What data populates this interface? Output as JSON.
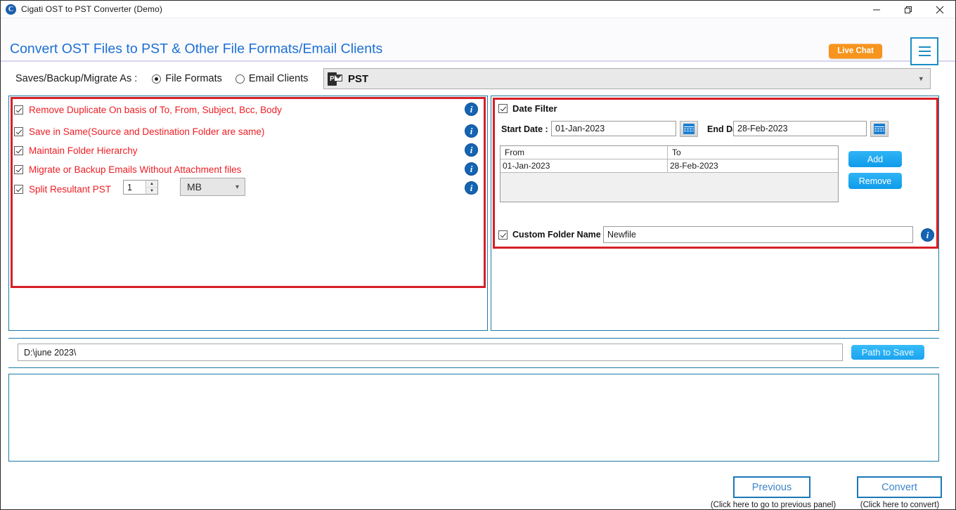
{
  "window": {
    "title": "Cigati OST to PST Converter (Demo)",
    "logo_letter": "C",
    "minimize_icon": "minimize-icon",
    "maximize_icon": "maximize-icon",
    "close_icon": "close-icon"
  },
  "header": {
    "title": "Convert OST Files to PST & Other File Formats/Email Clients",
    "live_chat_label": "Live Chat",
    "menu_icon": "hamburger-menu-icon"
  },
  "save_row": {
    "label": "Saves/Backup/Migrate As :",
    "options": [
      {
        "label": "File Formats",
        "selected": true
      },
      {
        "label": "Email Clients",
        "selected": false
      }
    ],
    "format_select": {
      "value": "PST",
      "icon": "outlook-pst-file-icon",
      "arrow": "chevron-down-icon"
    }
  },
  "left_panel": {
    "options": [
      {
        "label": "Remove Duplicate On basis of To, From, Subject, Bcc, Body",
        "checked": true,
        "info": "i"
      },
      {
        "label": "Save in Same(Source and Destination Folder are same)",
        "checked": true,
        "info": "i"
      },
      {
        "label": "Maintain Folder Hierarchy",
        "checked": true,
        "info": "i"
      },
      {
        "label": "Migrate or Backup Emails Without Attachment files",
        "checked": true,
        "info": "i"
      },
      {
        "label": "Split Resultant PST",
        "checked": true,
        "info": "i"
      }
    ],
    "split_size": "1",
    "split_unit": "MB",
    "split_unit_arrow": "chevron-down-icon",
    "spinner_up": "▲",
    "spinner_down": "▼"
  },
  "right_panel": {
    "date_filter": {
      "label": "Date Filter",
      "checked": true,
      "start_label": "Start Date :",
      "start_value": "01-Jan-2023",
      "end_label": "End Date :",
      "end_value": "28-Feb-2023",
      "calendar_icon": "calendar-icon"
    },
    "grid": {
      "columns": [
        "From",
        "To"
      ],
      "rows": [
        {
          "from": "01-Jan-2023",
          "to": "28-Feb-2023"
        }
      ]
    },
    "add_label": "Add",
    "remove_label": "Remove",
    "custom_folder": {
      "label": "Custom Folder Name",
      "checked": true,
      "value": "Newfile",
      "info": "i"
    }
  },
  "path_row": {
    "value": "D:\\june 2023\\",
    "placeholder": "",
    "button_label": "Path to Save"
  },
  "footer": {
    "previous_label": "Previous",
    "previous_hint": "(Click here to go to previous panel)",
    "convert_label": "Convert",
    "convert_hint": "(Click here to convert)"
  },
  "colors": {
    "accent_blue": "#1b6fd4",
    "panel_border": "#1c7aa8",
    "highlight_red": "#d61f26",
    "option_text_red": "#ee1d23",
    "live_chat_orange": "#f7941e",
    "button_blue": "#0f9bea"
  }
}
